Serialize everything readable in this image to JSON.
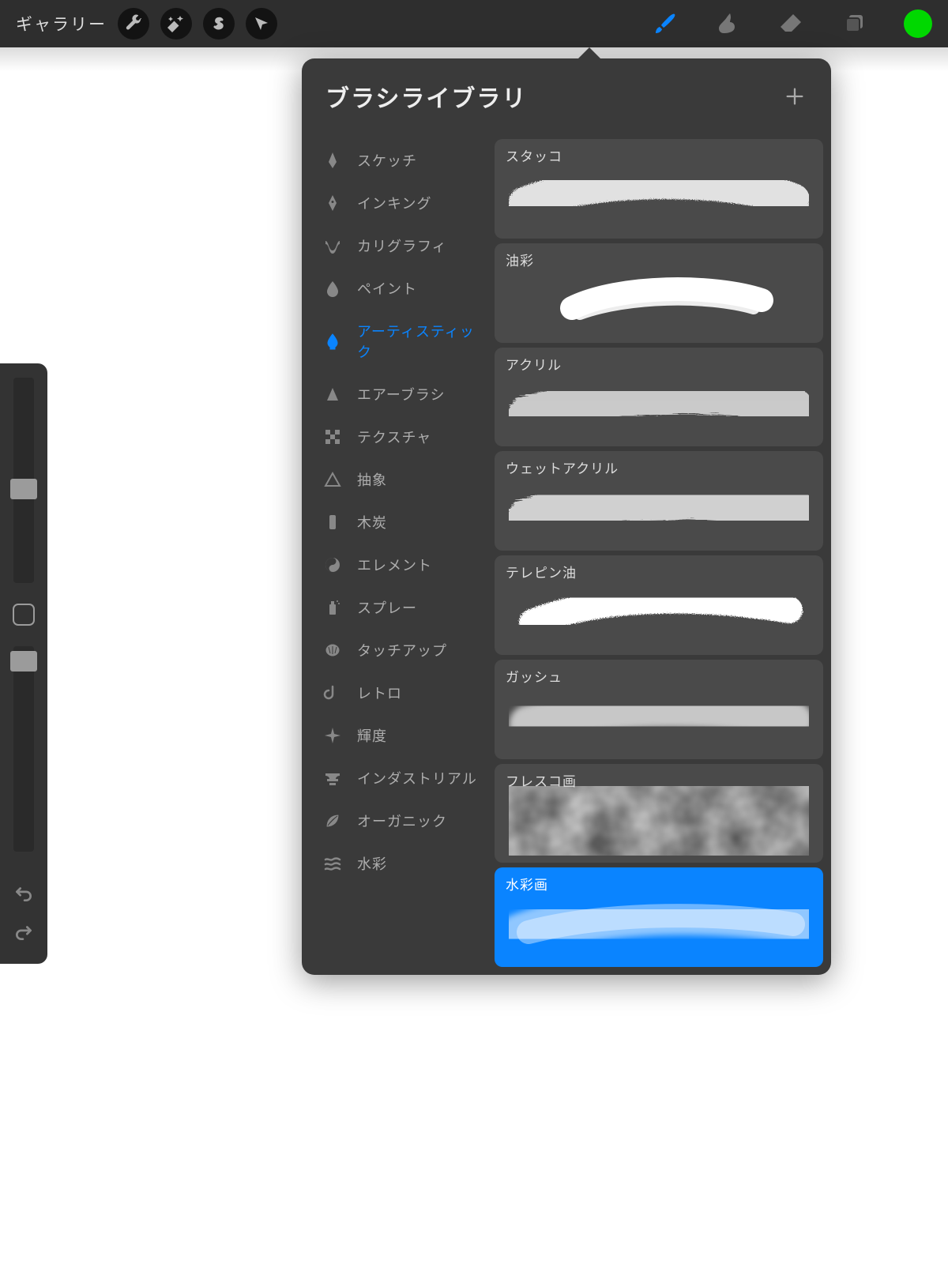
{
  "topbar": {
    "gallery_label": "ギャラリー",
    "color_chip": "#00d800"
  },
  "popover": {
    "title": "ブラシライブラリ"
  },
  "categories": [
    {
      "id": "sketch",
      "label": "スケッチ",
      "icon": "pencil"
    },
    {
      "id": "inking",
      "label": "インキング",
      "icon": "nib"
    },
    {
      "id": "calligraphy",
      "label": "カリグラフィ",
      "icon": "ribbon"
    },
    {
      "id": "paint",
      "label": "ペイント",
      "icon": "drop"
    },
    {
      "id": "artistic",
      "label": "アーティスティック",
      "icon": "brush",
      "active": true
    },
    {
      "id": "airbrush",
      "label": "エアーブラシ",
      "icon": "spray-cone"
    },
    {
      "id": "texture",
      "label": "テクスチャ",
      "icon": "checker"
    },
    {
      "id": "abstract",
      "label": "抽象",
      "icon": "triangle"
    },
    {
      "id": "charcoal",
      "label": "木炭",
      "icon": "stick"
    },
    {
      "id": "elements",
      "label": "エレメント",
      "icon": "yinyang"
    },
    {
      "id": "spray",
      "label": "スプレー",
      "icon": "can"
    },
    {
      "id": "touchup",
      "label": "タッチアップ",
      "icon": "shell"
    },
    {
      "id": "retro",
      "label": "レトロ",
      "icon": "retro"
    },
    {
      "id": "luminance",
      "label": "輝度",
      "icon": "sparkle"
    },
    {
      "id": "industrial",
      "label": "インダストリアル",
      "icon": "anvil"
    },
    {
      "id": "organic",
      "label": "オーガニック",
      "icon": "leaf"
    },
    {
      "id": "water",
      "label": "水彩",
      "icon": "waves"
    }
  ],
  "brushes": [
    {
      "id": "stucco",
      "label": "スタッコ",
      "style": "gritty"
    },
    {
      "id": "oil",
      "label": "油彩",
      "style": "oil"
    },
    {
      "id": "acrylic",
      "label": "アクリル",
      "style": "fiber"
    },
    {
      "id": "wetacrylic",
      "label": "ウェットアクリル",
      "style": "wetfiber"
    },
    {
      "id": "turpentine",
      "label": "テレピン油",
      "style": "splashy"
    },
    {
      "id": "gouache",
      "label": "ガッシュ",
      "style": "soft"
    },
    {
      "id": "fresco",
      "label": "フレスコ画",
      "style": "cloud"
    },
    {
      "id": "watercolor",
      "label": "水彩画",
      "style": "wash",
      "selected": true
    }
  ]
}
